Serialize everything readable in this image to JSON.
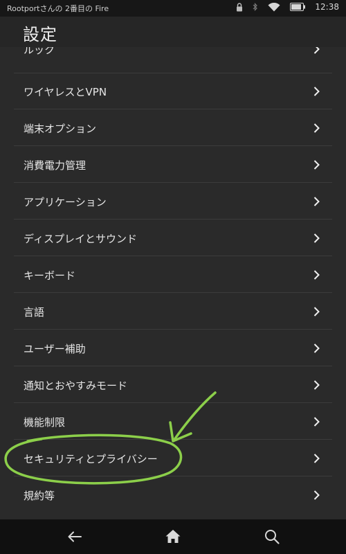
{
  "status_bar": {
    "title": "Rootportさんの 2番目の Fire",
    "time": "12:38",
    "icons": [
      "lock-icon",
      "bluetooth-icon",
      "wifi-icon",
      "battery-icon"
    ]
  },
  "header": {
    "title": "設定"
  },
  "settings_list": {
    "partial_item": "ルック",
    "items": [
      {
        "label": "ワイヤレスとVPN"
      },
      {
        "label": "端末オプション"
      },
      {
        "label": "消費電力管理"
      },
      {
        "label": "アプリケーション"
      },
      {
        "label": "ディスプレイとサウンド"
      },
      {
        "label": "キーボード"
      },
      {
        "label": "言語"
      },
      {
        "label": "ユーザー補助"
      },
      {
        "label": "通知とおやすみモード"
      },
      {
        "label": "機能制限"
      },
      {
        "label": "セキュリティとプライバシー"
      },
      {
        "label": "規約等"
      }
    ]
  },
  "navigation": {
    "icons": [
      "back-arrow-icon",
      "home-icon",
      "search-icon"
    ]
  },
  "colors": {
    "background": "#2a2a2a",
    "text": "#e6e6e6",
    "annotation": "#8ccf4a"
  }
}
